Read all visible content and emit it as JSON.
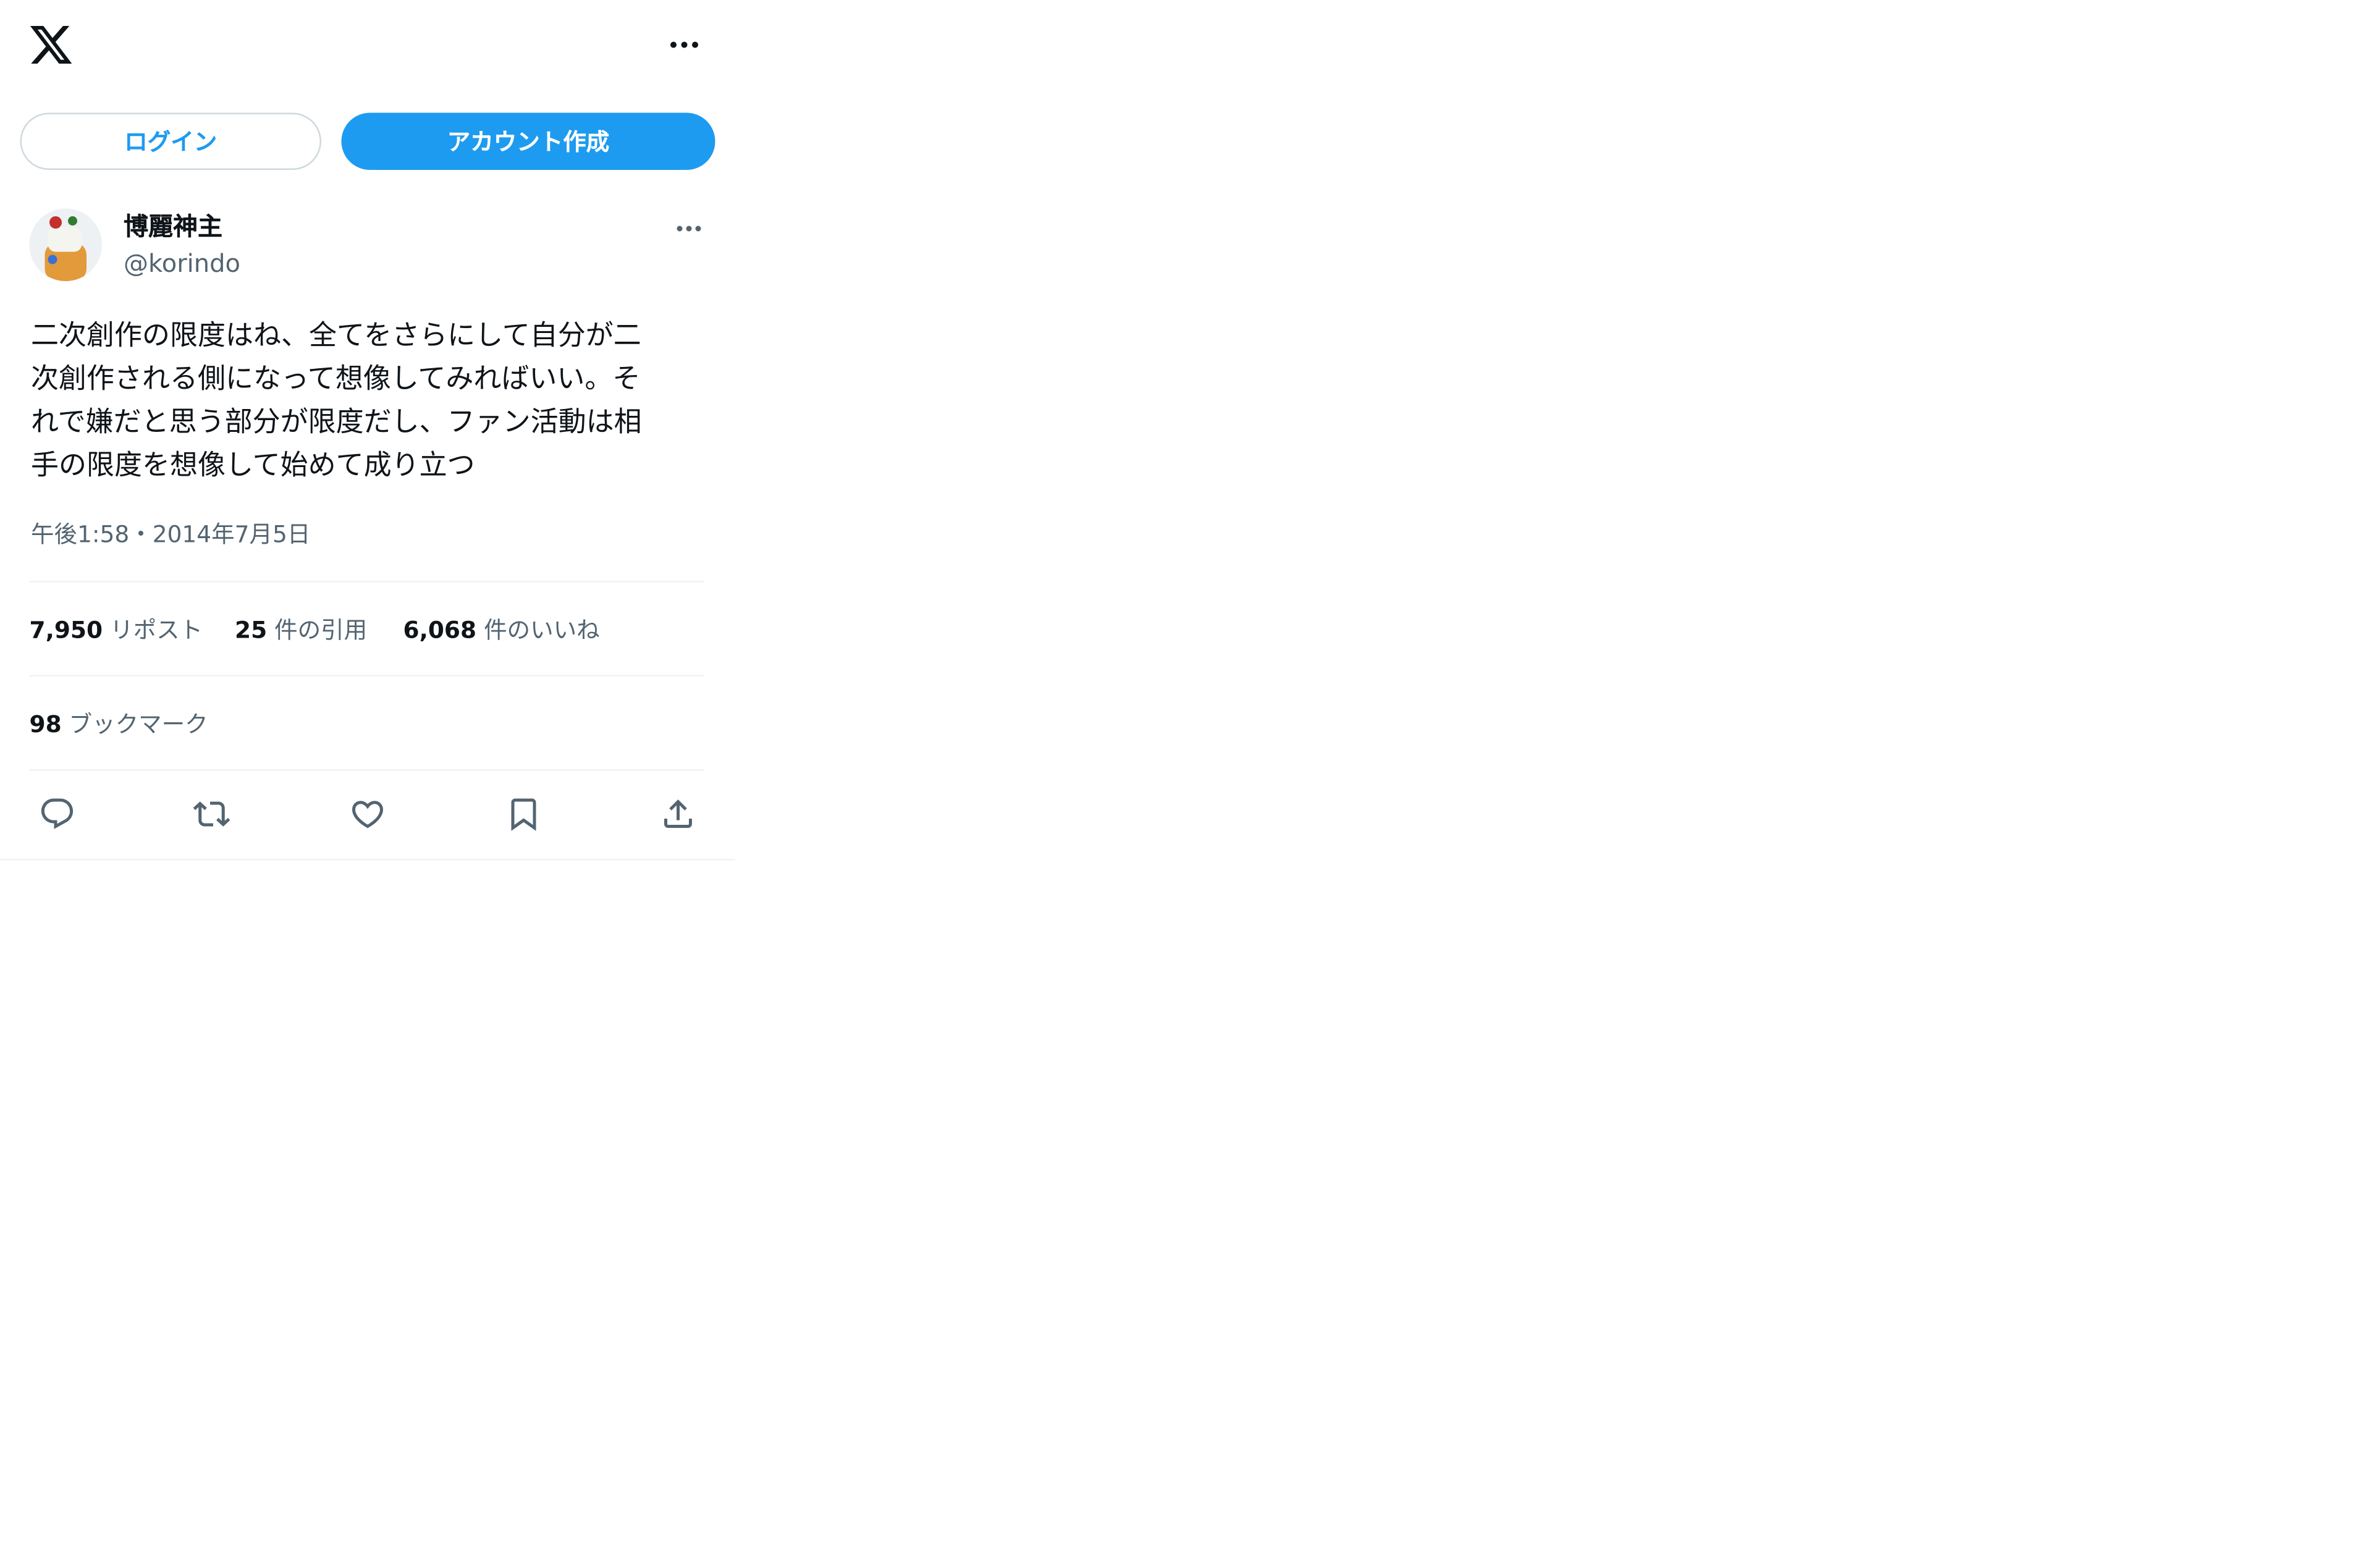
{
  "header": {
    "logo_icon": "x-logo-icon",
    "more_icon": "more-horizontal-icon"
  },
  "auth": {
    "login_label": "ログイン",
    "signup_label": "アカウント作成",
    "accent_color": "#1d9bf0"
  },
  "tweet": {
    "author_name": "博麗神主",
    "author_handle": "@korindo",
    "text": "二次創作の限度はね、全てをさらにして自分が二\n次創作される側になって想像してみればいい。そ\nれで嫌だと思う部分が限度だし、ファン活動は相\n手の限度を想像して始めて成り立つ",
    "timestamp": "午後1:58・2014年7月5日",
    "stats": {
      "reposts_count": "7,950",
      "reposts_label": "リポスト",
      "quotes_count": "25",
      "quotes_label": "件の引用",
      "likes_count": "6,068",
      "likes_label": "件のいいね",
      "bookmarks_count": "98",
      "bookmarks_label": "ブックマーク"
    },
    "actions": [
      "reply-icon",
      "retweet-icon",
      "like-icon",
      "bookmark-icon",
      "share-icon"
    ]
  }
}
